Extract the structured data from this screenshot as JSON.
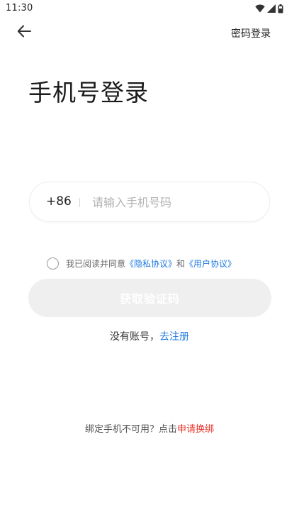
{
  "status_bar": {
    "time": "11:30"
  },
  "header": {
    "back_icon": "arrow-left-icon",
    "password_login_label": "密码登录"
  },
  "page": {
    "title": "手机号登录"
  },
  "phone_input": {
    "country_code": "+86",
    "placeholder": "请输入手机号码",
    "value": ""
  },
  "agreement": {
    "prefix": "我已阅读并同意",
    "privacy_link": "《隐私协议》",
    "conjunction": "和",
    "user_link": "《用户协议》",
    "checked": false
  },
  "get_code_button": {
    "label": "获取验证码",
    "enabled": false
  },
  "register": {
    "prefix": "没有账号，",
    "link": "去注册"
  },
  "rebind": {
    "prefix": "绑定手机不可用？点击",
    "link": "申请换绑"
  },
  "colors": {
    "link_blue": "#1f7ae0",
    "link_red": "#e8382f",
    "button_disabled_bg": "#efefef"
  }
}
